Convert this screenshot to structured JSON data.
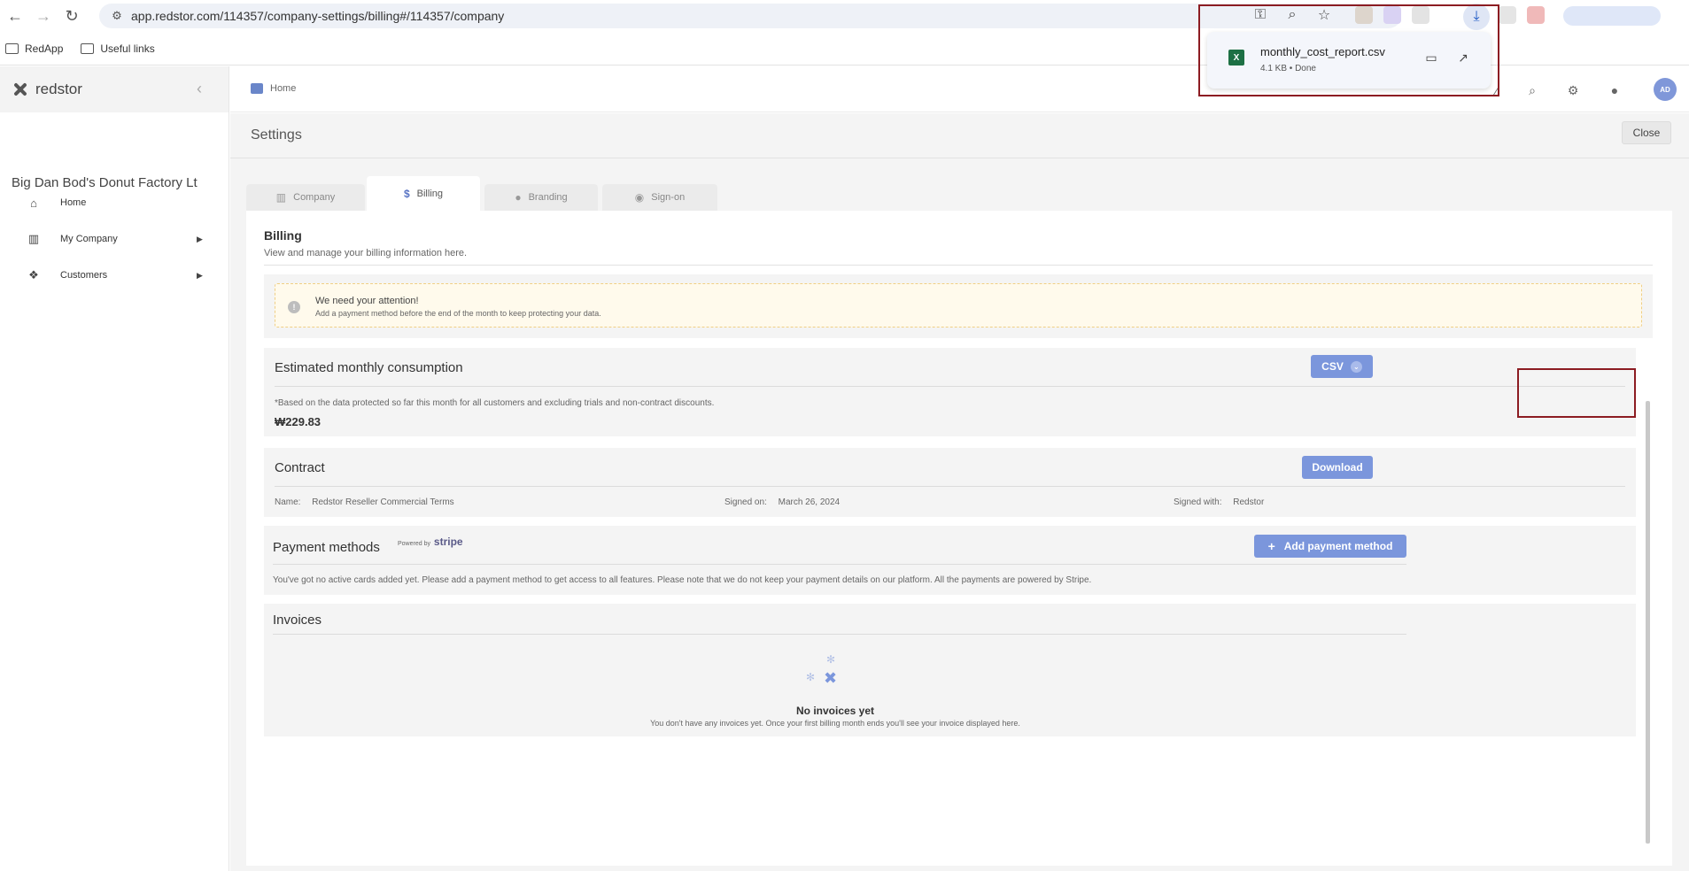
{
  "browser": {
    "url": "app.redstor.com/114357/company-settings/billing#/114357/company",
    "bookmarks": [
      "RedApp",
      "Useful links"
    ]
  },
  "download": {
    "filename": "monthly_cost_report.csv",
    "meta": "4.1 KB • Done"
  },
  "sidebar": {
    "brand": "redstor",
    "company": "Big Dan Bod's Donut Factory Lt",
    "items": [
      {
        "label": "Home"
      },
      {
        "label": "My Company"
      },
      {
        "label": "Customers"
      }
    ]
  },
  "header": {
    "breadcrumb": "Home",
    "avatar": "AD"
  },
  "settings": {
    "title": "Settings",
    "close": "Close",
    "tabs": [
      "Company",
      "Billing",
      "Branding",
      "Sign-on"
    ]
  },
  "billing": {
    "title": "Billing",
    "subtitle": "View and manage your billing information here.",
    "alert": {
      "title": "We need your attention!",
      "body": "Add a payment method before the end of the month to keep protecting your data."
    },
    "consumption": {
      "title": "Estimated monthly consumption",
      "csv_label": "CSV",
      "note": "*Based on the data protected so far this month for all customers and excluding trials and non-contract discounts.",
      "amount": "₩229.83"
    },
    "contract": {
      "title": "Contract",
      "download_label": "Download",
      "name_label": "Name:",
      "name_value": "Redstor Reseller Commercial Terms",
      "signed_on_label": "Signed on:",
      "signed_on_value": "March 26, 2024",
      "signed_with_label": "Signed with:",
      "signed_with_value": "Redstor"
    },
    "payment": {
      "title": "Payment methods",
      "powered_by": "Powered by",
      "stripe": "stripe",
      "add_label": "Add payment method",
      "note": "You've got no active cards added yet. Please add a payment method to get access to all features. Please note that we do not keep your payment details on our platform. All the payments are powered by Stripe."
    },
    "invoices": {
      "title": "Invoices",
      "empty_title": "No invoices yet",
      "empty_body": "You don't have any invoices yet. Once your first billing month ends you'll see your invoice displayed here."
    }
  },
  "colors": {
    "accent": "#7b96dc",
    "highlight": "#8c1c22",
    "alert_bg": "#fffaec"
  }
}
